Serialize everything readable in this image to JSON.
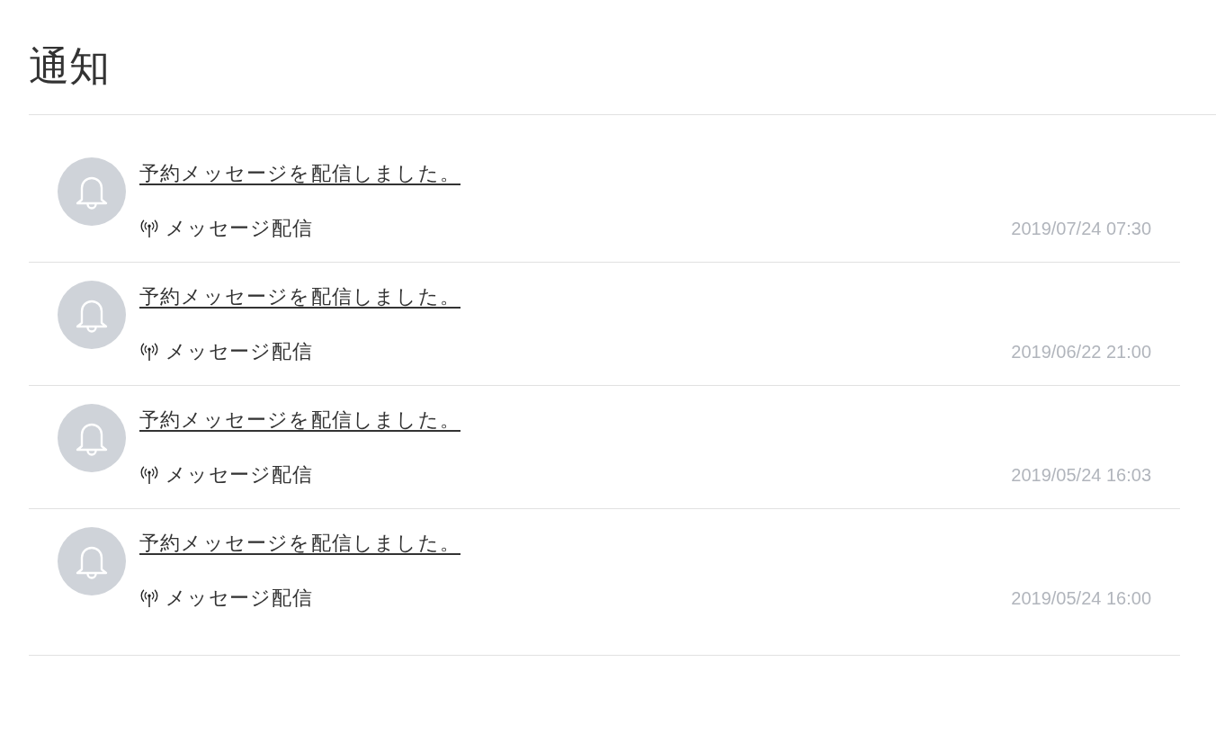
{
  "page": {
    "title": "通知"
  },
  "notifications": [
    {
      "title": "予約メッセージを配信しました。",
      "category": "メッセージ配信",
      "timestamp": "2019/07/24 07:30"
    },
    {
      "title": "予約メッセージを配信しました。",
      "category": "メッセージ配信",
      "timestamp": "2019/06/22 21:00"
    },
    {
      "title": "予約メッセージを配信しました。",
      "category": "メッセージ配信",
      "timestamp": "2019/05/24 16:03"
    },
    {
      "title": "予約メッセージを配信しました。",
      "category": "メッセージ配信",
      "timestamp": "2019/05/24 16:00"
    }
  ]
}
